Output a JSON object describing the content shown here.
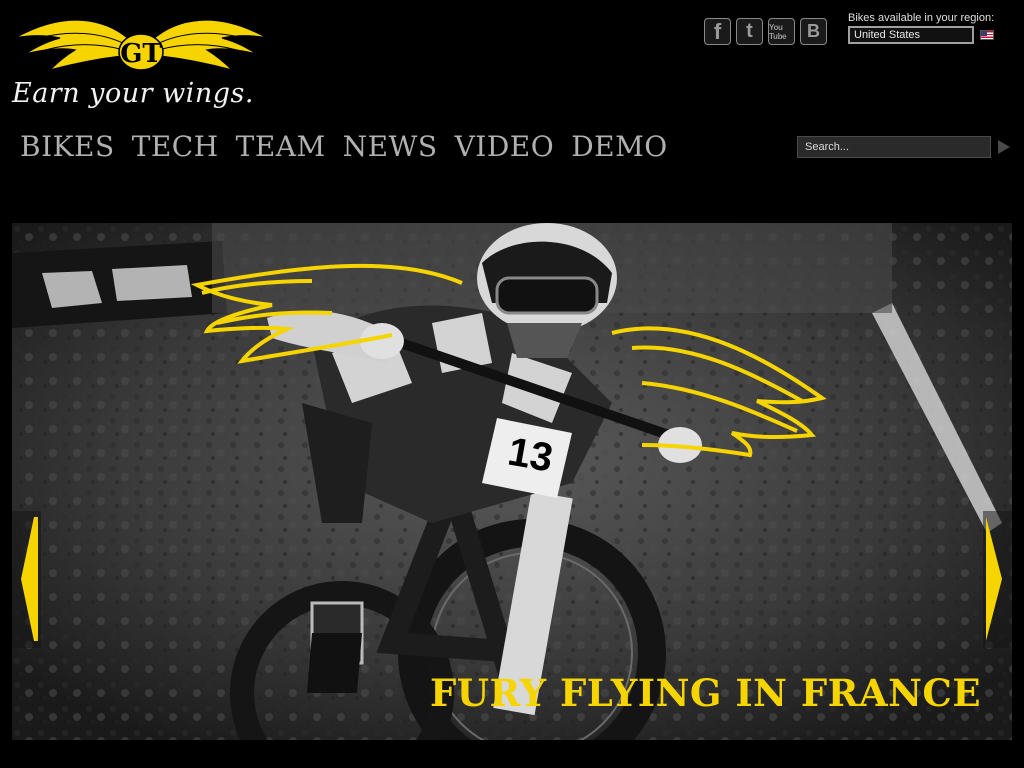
{
  "brand": {
    "logo_text": "GT",
    "tagline": "Earn your wings."
  },
  "social": {
    "items": [
      {
        "name": "facebook",
        "glyph": "f"
      },
      {
        "name": "twitter",
        "glyph": "t"
      },
      {
        "name": "youtube",
        "glyph": "You Tube"
      },
      {
        "name": "blogger",
        "glyph": "B"
      }
    ]
  },
  "region": {
    "label": "Bikes available in your region:",
    "selected": "United States",
    "flag": "us-flag-icon"
  },
  "nav": {
    "items": [
      "BIKES",
      "TECH",
      "TEAM",
      "NEWS",
      "VIDEO",
      "DEMO"
    ]
  },
  "search": {
    "placeholder": "Search..."
  },
  "hero": {
    "caption": "FURY FLYING IN FRANCE",
    "image": "downhill-rider-with-wings-photo"
  },
  "colors": {
    "accent": "#f5d400",
    "background": "#000000",
    "nav_text": "#b0b0b0"
  }
}
